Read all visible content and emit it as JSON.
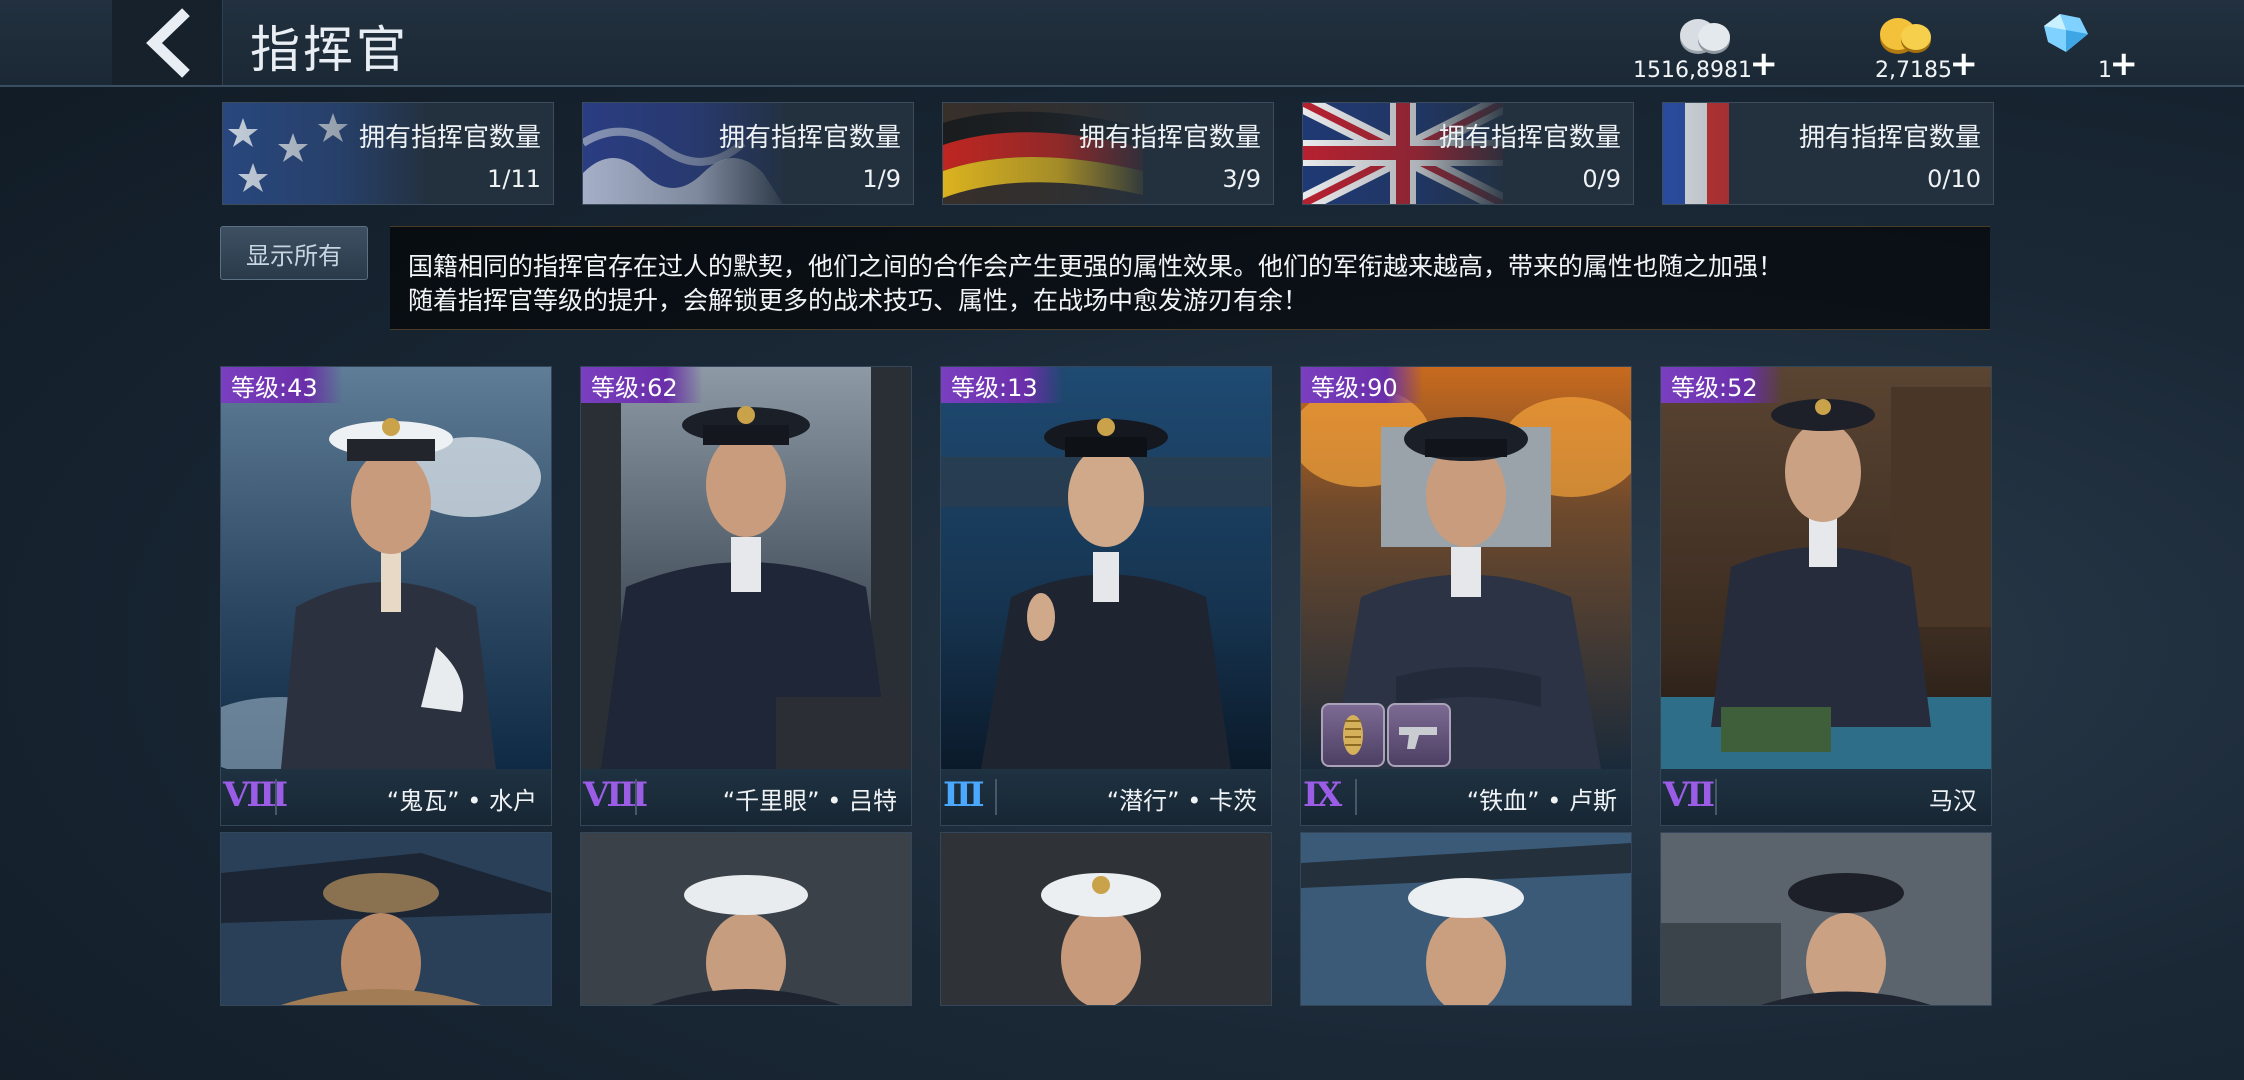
{
  "header": {
    "title": "指挥官",
    "currencies": [
      {
        "icon": "silver-coins-icon",
        "value": "1516,8981"
      },
      {
        "icon": "gold-coins-icon",
        "value": "2,7185"
      },
      {
        "icon": "diamond-icon",
        "value": "1"
      }
    ],
    "plus_symbol": "+"
  },
  "nations": [
    {
      "flag": "usa-flag",
      "label": "拥有指挥官数量",
      "count": "1/11"
    },
    {
      "flag": "japan-flag",
      "label": "拥有指挥官数量",
      "count": "1/9"
    },
    {
      "flag": "germany-flag",
      "label": "拥有指挥官数量",
      "count": "3/9"
    },
    {
      "flag": "uk-flag",
      "label": "拥有指挥官数量",
      "count": "0/9"
    },
    {
      "flag": "france-flag",
      "label": "拥有指挥官数量",
      "count": "0/10"
    }
  ],
  "filter": {
    "show_all_label": "显示所有"
  },
  "description": {
    "line1": "国籍相同的指挥官存在过人的默契，他们之间的合作会产生更强的属性效果。他们的军衔越来越高，带来的属性也随之加强！",
    "line2": "随着指挥官等级的提升，会解锁更多的战术技巧、属性，在战场中愈发游刃有余！"
  },
  "commanders": [
    {
      "level": "等级:43",
      "rank": "VIII",
      "rank_color": "#9b5de5",
      "name": "“鬼瓦” • 水户",
      "items": []
    },
    {
      "level": "等级:62",
      "rank": "VIII",
      "rank_color": "#9b5de5",
      "name": "“千里眼” • 吕特",
      "items": []
    },
    {
      "level": "等级:13",
      "rank": "III",
      "rank_color": "#4aa8ff",
      "name": "“潜行” • 卡茨",
      "items": []
    },
    {
      "level": "等级:90",
      "rank": "IX",
      "rank_color": "#9b5de5",
      "name": "“铁血” • 卢斯",
      "items": [
        "medal-item-icon",
        "pistol-item-icon"
      ]
    },
    {
      "level": "等级:52",
      "rank": "VII",
      "rank_color": "#9b5de5",
      "name": "马汉",
      "items": []
    }
  ],
  "second_row": [
    {
      "portrait": "commander-portrait"
    },
    {
      "portrait": "commander-portrait"
    },
    {
      "portrait": "commander-portrait"
    },
    {
      "portrait": "commander-portrait"
    },
    {
      "portrait": "commander-portrait"
    }
  ],
  "colors": {
    "level_badge": "#7a3fc0",
    "rank_purple": "#9b5de5",
    "rank_blue": "#4aa8ff"
  }
}
